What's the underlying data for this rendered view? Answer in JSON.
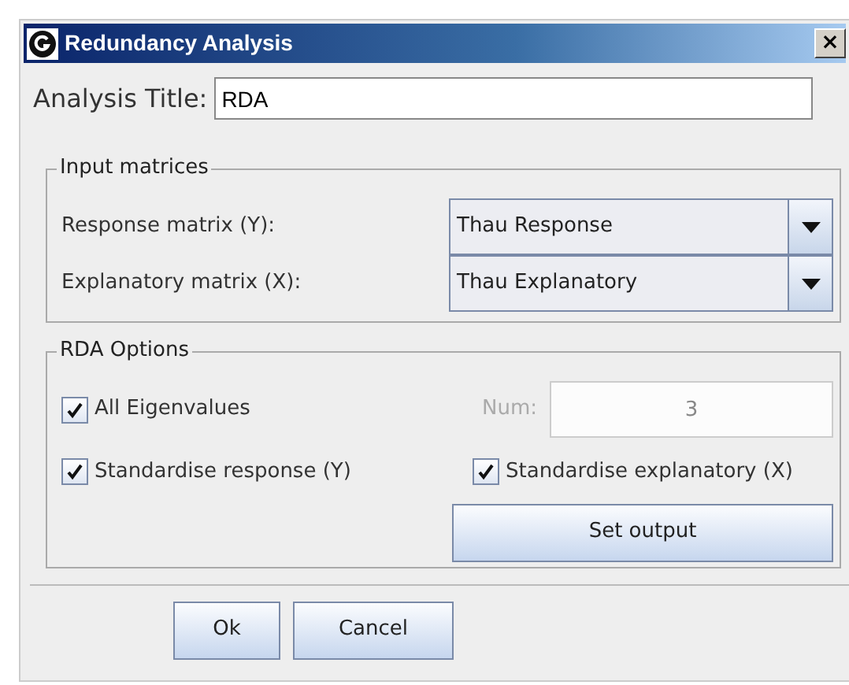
{
  "window": {
    "title": "Redundancy Analysis",
    "close": "×"
  },
  "title_field": {
    "label": "Analysis Title:",
    "value": "RDA"
  },
  "input_matrices": {
    "legend": "Input matrices",
    "rows": [
      {
        "label": "Response matrix (Y):",
        "value": "Thau Response"
      },
      {
        "label": "Explanatory matrix (X):",
        "value": "Thau Explanatory"
      }
    ]
  },
  "rda_options": {
    "legend": "RDA Options",
    "checkboxes": [
      {
        "label": "All Eigenvalues",
        "checked": true
      },
      {
        "label": "Standardise response (Y)",
        "checked": true
      },
      {
        "label": "Standardise explanatory (X)",
        "checked": true
      }
    ],
    "num": {
      "label": "Num:",
      "value": "3",
      "disabled": true
    },
    "set_output": "Set output"
  },
  "buttons": [
    "Ok",
    "Cancel"
  ]
}
